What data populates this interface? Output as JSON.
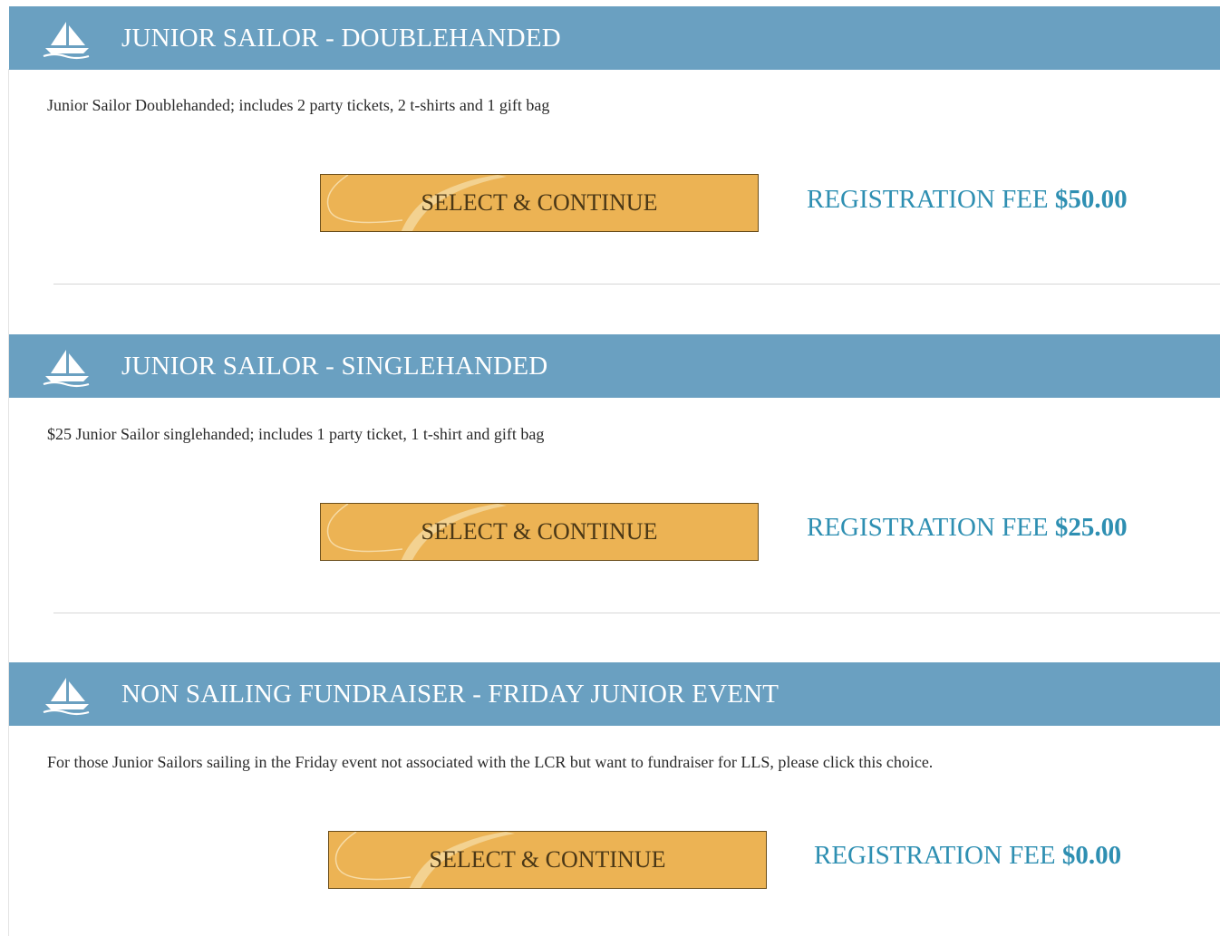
{
  "colors": {
    "header_bg": "#6aa0c1",
    "button_bg": "#ecb354",
    "fee_text": "#2e8fb2"
  },
  "options": [
    {
      "icon": "sailboat-icon",
      "title": "JUNIOR SAILOR - DOUBLEHANDED",
      "description": "Junior Sailor Doublehanded; includes 2 party tickets, 2 t-shirts and 1 gift bag",
      "button_label": "SELECT & CONTINUE",
      "fee_label": "REGISTRATION FEE",
      "fee_amount": "$50.00"
    },
    {
      "icon": "sailboat-icon",
      "title": "JUNIOR SAILOR - SINGLEHANDED",
      "description": "$25 Junior Sailor singlehanded; includes 1 party ticket, 1 t-shirt and gift bag",
      "button_label": "SELECT & CONTINUE",
      "fee_label": "REGISTRATION FEE",
      "fee_amount": "$25.00"
    },
    {
      "icon": "sailboat-icon",
      "title": "NON SAILING FUNDRAISER - FRIDAY JUNIOR EVENT",
      "description": "For those Junior Sailors sailing in the Friday event not associated with the LCR but want to fundraiser for LLS, please click this choice.",
      "button_label": "SELECT & CONTINUE",
      "fee_label": "REGISTRATION FEE",
      "fee_amount": "$0.00"
    }
  ]
}
